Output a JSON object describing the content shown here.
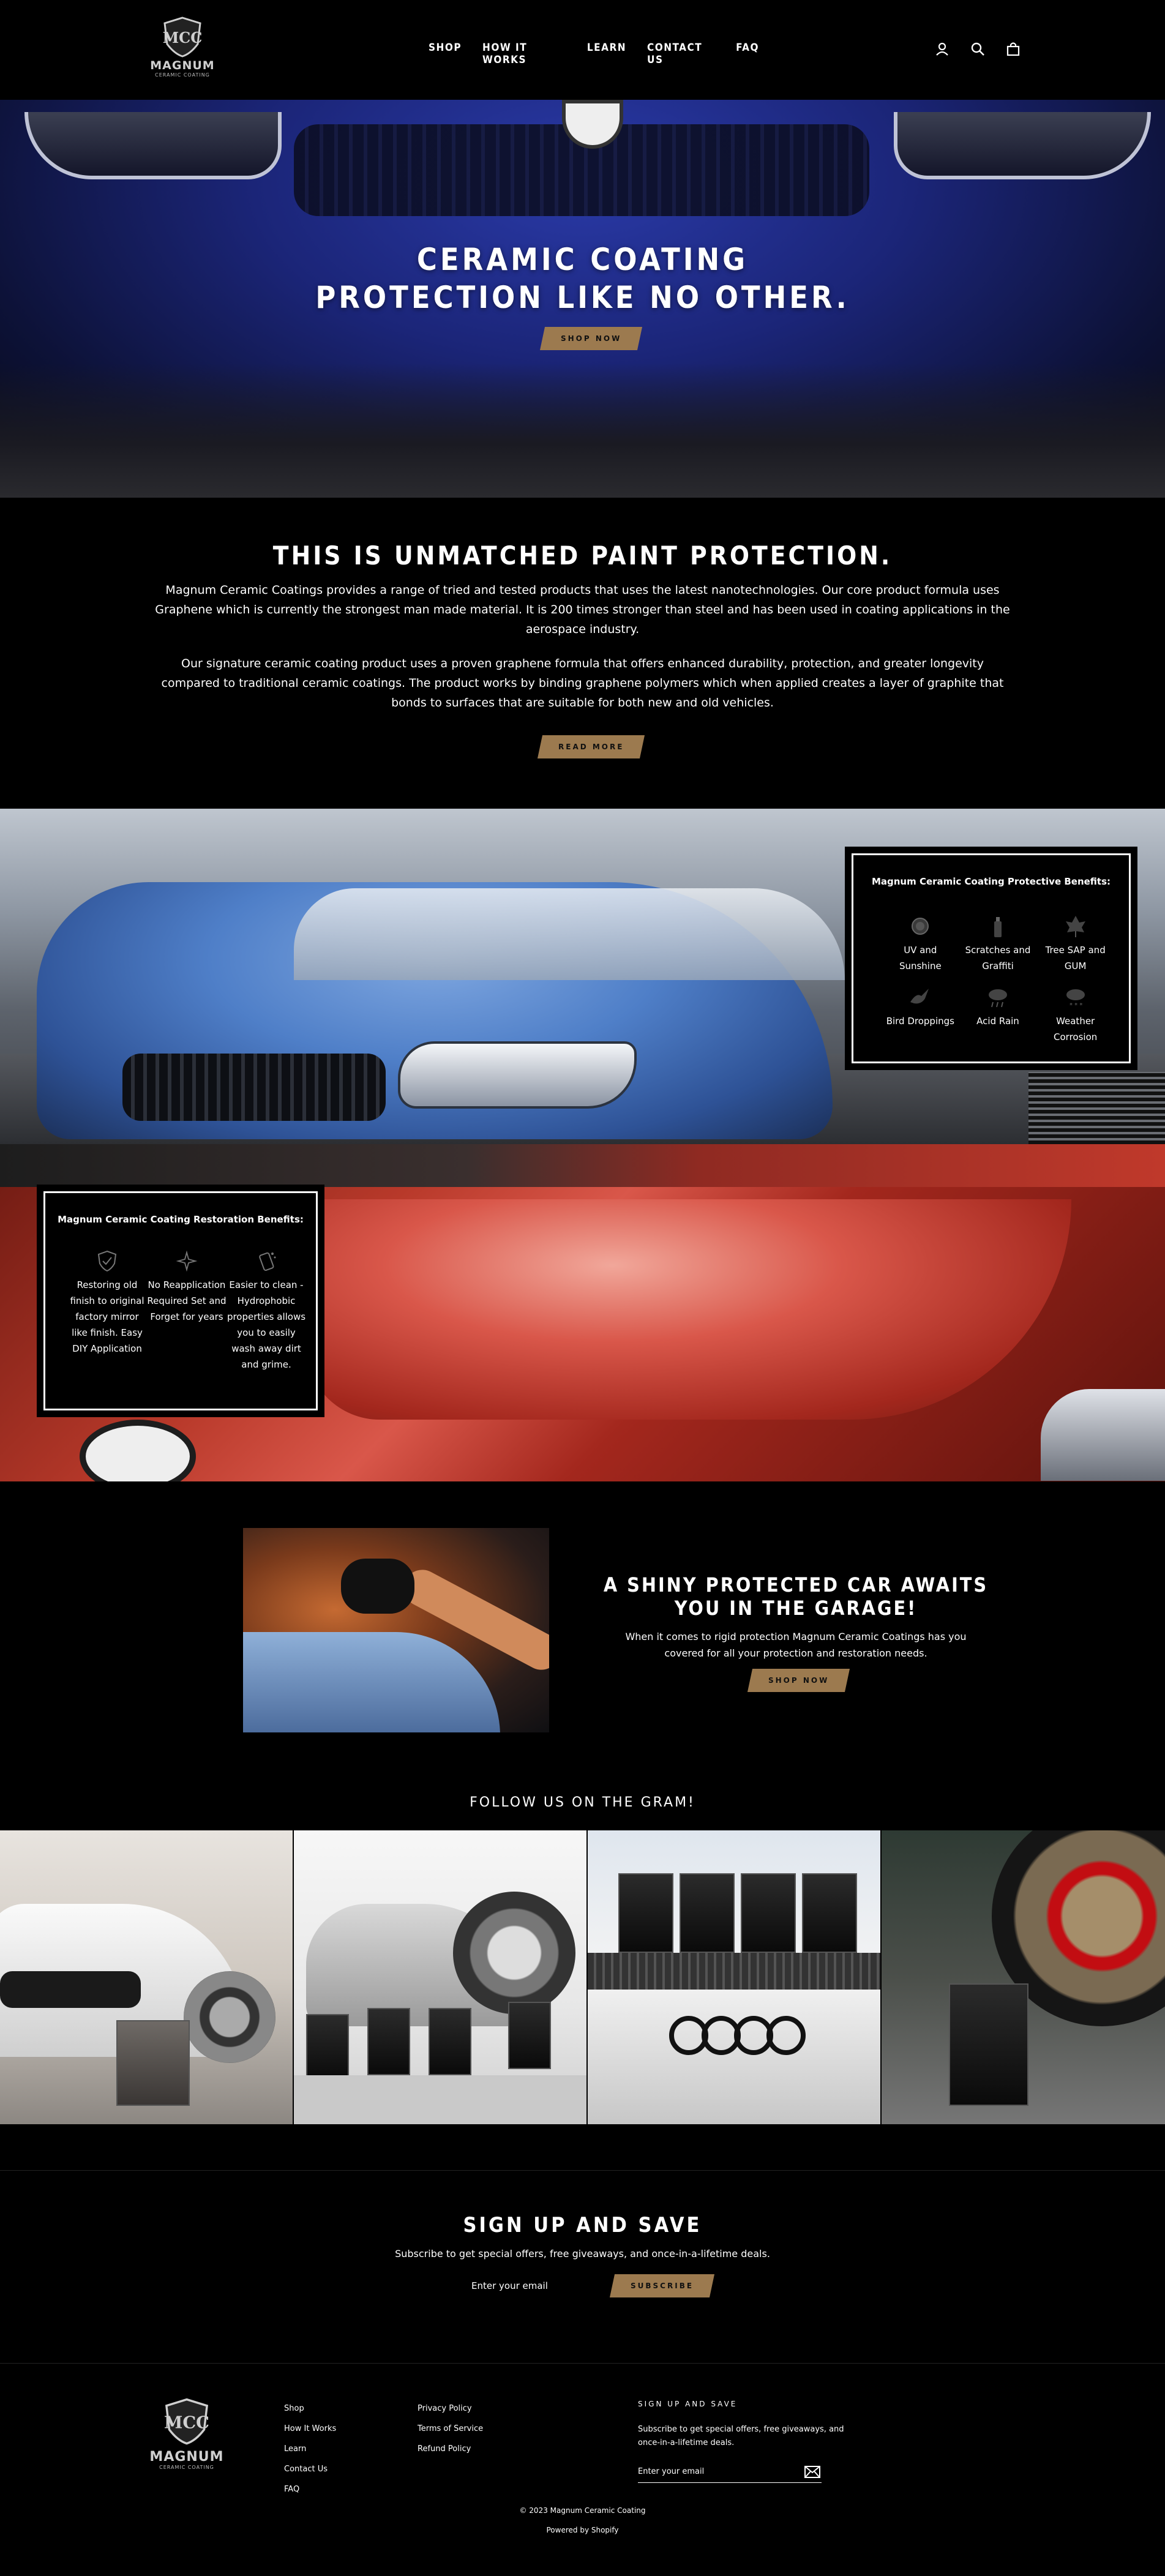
{
  "header": {
    "brand": "MAGNUM",
    "brand_sub": "CERAMIC COATING",
    "nav": [
      "SHOP",
      "HOW IT WORKS",
      "LEARN",
      "CONTACT US",
      "FAQ"
    ],
    "icons": [
      "account-icon",
      "search-icon",
      "cart-icon"
    ]
  },
  "hero": {
    "title_line1": "CERAMIC COATING",
    "title_line2": "PROTECTION LIKE NO OTHER.",
    "button": "SHOP NOW"
  },
  "intro": {
    "title": "THIS IS UNMATCHED PAINT PROTECTION.",
    "p1": "Magnum Ceramic Coatings provides a range of tried and tested products that uses the latest nanotechnologies. Our core product formula uses Graphene which is currently the strongest man made material. It is 200 times stronger than steel and has been used in coating applications in the aerospace industry.",
    "p2": "Our signature ceramic coating product uses a proven graphene formula that offers enhanced durability, protection, and greater longevity compared to traditional ceramic coatings. The product works by binding graphene polymers which when applied creates a layer of graphite that bonds to surfaces that are suitable for both new and old vehicles.",
    "button": "READ MORE"
  },
  "protective": {
    "title": "Magnum Ceramic Coating Protective Benefits:",
    "items": [
      {
        "label": "UV and Sunshine",
        "icon": "sun-icon"
      },
      {
        "label": "Scratches and Graffiti",
        "icon": "spray-can-icon"
      },
      {
        "label": "Tree SAP and GUM",
        "icon": "leaf-icon"
      },
      {
        "label": "Bird Droppings",
        "icon": "bird-icon"
      },
      {
        "label": "Acid Rain",
        "icon": "rain-cloud-icon"
      },
      {
        "label": "Weather Corrosion",
        "icon": "snow-cloud-icon"
      }
    ]
  },
  "restoration": {
    "title": "Magnum Ceramic Coating Restoration Benefits:",
    "items": [
      {
        "label": "Restoring old finish to original factory mirror like finish. Easy DIY Application",
        "icon": "shield-check-icon"
      },
      {
        "label": "No Reapplication Required Set and Forget for years",
        "icon": "sparkle-icon"
      },
      {
        "label": "Easier to clean - Hydrophobic properties allows you to easily wash away dirt and grime.",
        "icon": "wash-icon"
      }
    ]
  },
  "garage": {
    "title_line1": "A SHINY PROTECTED CAR AWAITS",
    "title_line2": "YOU IN THE GARAGE!",
    "text": "When it comes to rigid protection Magnum Ceramic Coatings has you covered for all your protection and restoration needs.",
    "button": "SHOP NOW"
  },
  "gram": {
    "title": "FOLLOW US ON THE GRAM!"
  },
  "signup": {
    "title": "SIGN UP AND SAVE",
    "text": "Subscribe to get special offers, free giveaways, and once-in-a-lifetime deals.",
    "placeholder": "Enter your email",
    "button": "SUBSCRIBE"
  },
  "footer": {
    "col1": [
      "Shop",
      "How It Works",
      "Learn",
      "Contact Us",
      "FAQ"
    ],
    "col2": [
      "Privacy Policy",
      "Terms of Service",
      "Refund Policy"
    ],
    "news_title": "SIGN UP AND SAVE",
    "news_text": "Subscribe to get special offers, free giveaways, and once-in-a-lifetime deals.",
    "news_placeholder": "Enter your email",
    "copyright": "© 2023 Magnum Ceramic Coating",
    "powered": "Powered by Shopify"
  },
  "colors": {
    "accent_gold": "#9c7a4f",
    "background": "#000000",
    "text": "#ffffff"
  }
}
